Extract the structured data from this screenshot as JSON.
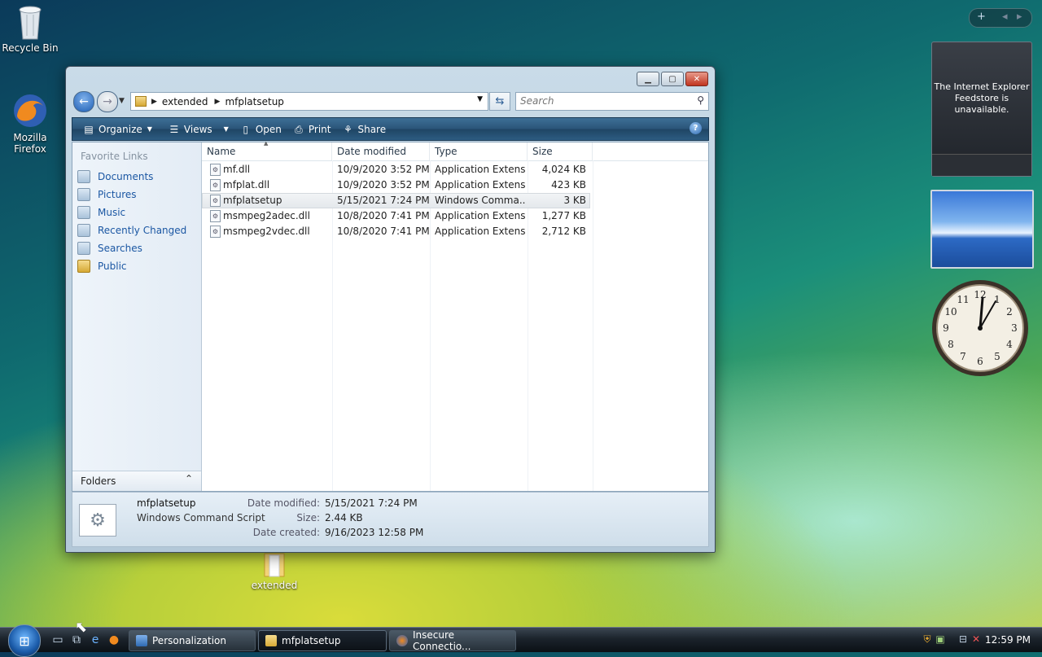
{
  "desktop": {
    "icons": [
      {
        "label": "Recycle Bin",
        "icon": "recycle-bin-icon"
      },
      {
        "label": "Mozilla Firefox",
        "icon": "firefox-icon"
      },
      {
        "label": "extended",
        "icon": "folder-icon"
      }
    ]
  },
  "gadgets": {
    "feed_message": "The Internet Explorer Feedstore is unavailable.",
    "clock_time": "12:59"
  },
  "explorer": {
    "address": [
      "extended",
      "mfplatsetup"
    ],
    "search_placeholder": "Search",
    "toolbar": {
      "organize": "Organize",
      "views": "Views",
      "open": "Open",
      "print": "Print",
      "share": "Share"
    },
    "favorite_links_title": "Favorite Links",
    "favorite_links": [
      "Documents",
      "Pictures",
      "Music",
      "Recently Changed",
      "Searches",
      "Public"
    ],
    "folders_label": "Folders",
    "columns": [
      "Name",
      "Date modified",
      "Type",
      "Size"
    ],
    "files": [
      {
        "name": "mf.dll",
        "date": "10/9/2020 3:52 PM",
        "type": "Application Extens...",
        "size": "4,024 KB"
      },
      {
        "name": "mfplat.dll",
        "date": "10/9/2020 3:52 PM",
        "type": "Application Extens...",
        "size": "423 KB"
      },
      {
        "name": "mfplatsetup",
        "date": "5/15/2021 7:24 PM",
        "type": "Windows Comma...",
        "size": "3 KB"
      },
      {
        "name": "msmpeg2adec.dll",
        "date": "10/8/2020 7:41 PM",
        "type": "Application Extens...",
        "size": "1,277 KB"
      },
      {
        "name": "msmpeg2vdec.dll",
        "date": "10/8/2020 7:41 PM",
        "type": "Application Extens...",
        "size": "2,712 KB"
      }
    ],
    "selected_index": 2,
    "details": {
      "name": "mfplatsetup",
      "type": "Windows Command Script",
      "date_modified_label": "Date modified:",
      "date_modified": "5/15/2021 7:24 PM",
      "size_label": "Size:",
      "size": "2.44 KB",
      "date_created_label": "Date created:",
      "date_created": "9/16/2023 12:58 PM"
    }
  },
  "taskbar": {
    "tasks": [
      "Personalization",
      "mfplatsetup",
      "Insecure Connectio..."
    ],
    "active_task": 1,
    "time": "12:59 PM"
  }
}
